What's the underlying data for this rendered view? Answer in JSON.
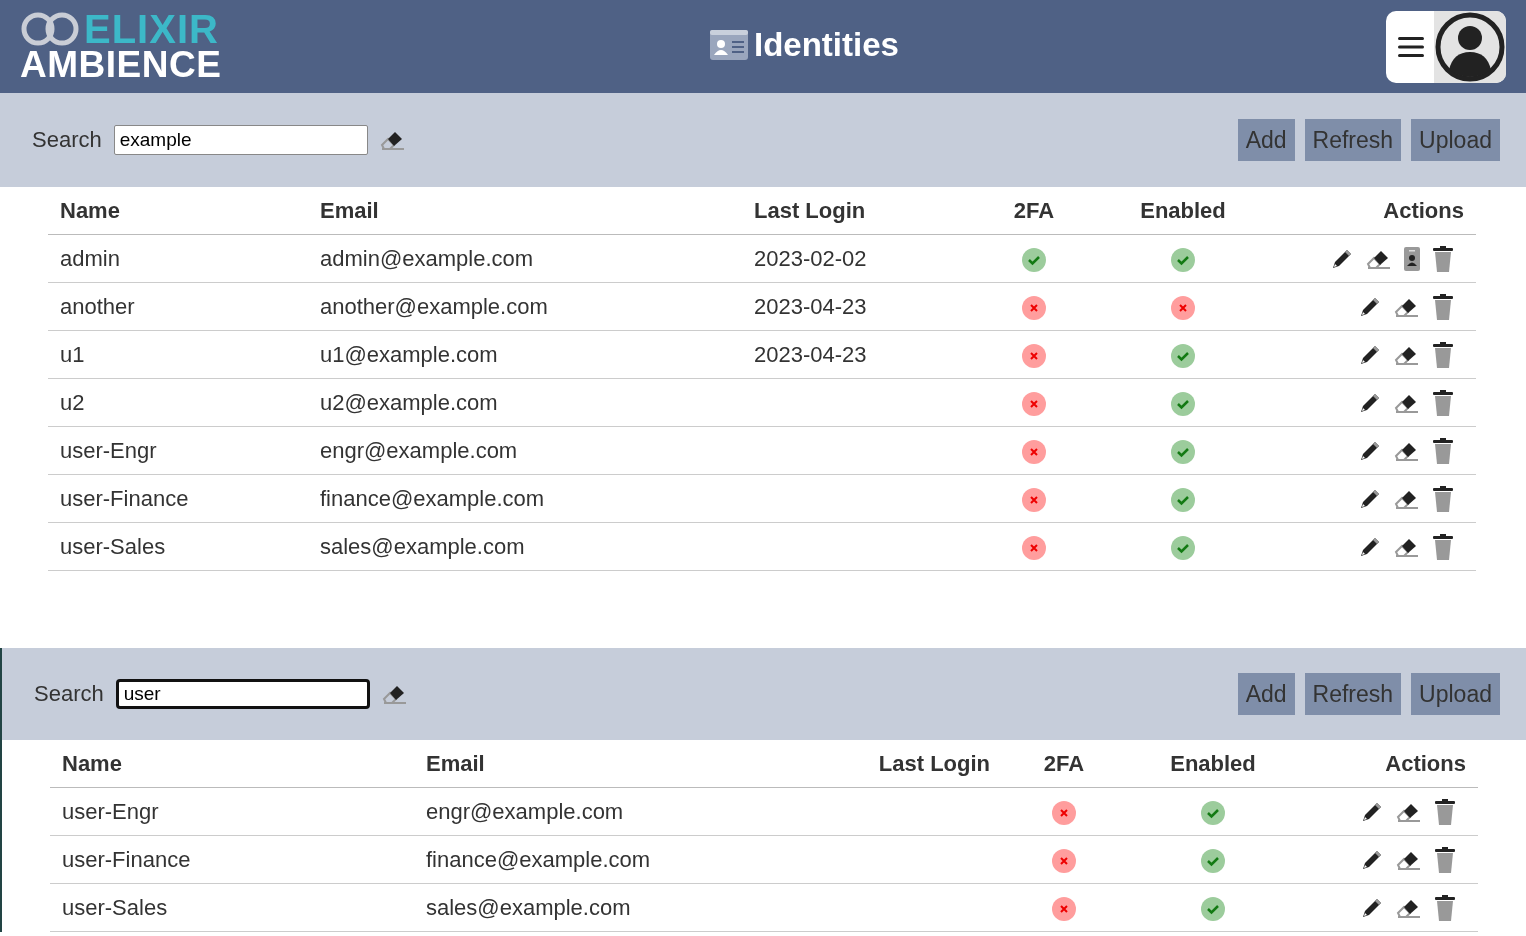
{
  "header": {
    "logo": {
      "top": "ELIXIR",
      "bottom": "AMBIENCE"
    },
    "title": "Identities"
  },
  "panels": [
    {
      "search": {
        "label": "Search",
        "value": "example",
        "focused": false
      },
      "buttons": [
        "Add",
        "Refresh",
        "Upload"
      ],
      "columns": [
        "Name",
        "Email",
        "Last Login",
        "2FA",
        "Enabled",
        "Actions"
      ],
      "rows": [
        {
          "name": "admin",
          "email": "admin@example.com",
          "last_login": "2023-02-02",
          "two_fa": true,
          "enabled": true,
          "badge": true
        },
        {
          "name": "another",
          "email": "another@example.com",
          "last_login": "2023-04-23",
          "two_fa": false,
          "enabled": false,
          "badge": false
        },
        {
          "name": "u1",
          "email": "u1@example.com",
          "last_login": "2023-04-23",
          "two_fa": false,
          "enabled": true,
          "badge": false
        },
        {
          "name": "u2",
          "email": "u2@example.com",
          "two_fa": false,
          "enabled": true,
          "badge": false
        },
        {
          "name": "user-Engr",
          "email": "engr@example.com",
          "two_fa": false,
          "enabled": true,
          "badge": false
        },
        {
          "name": "user-Finance",
          "email": "finance@example.com",
          "two_fa": false,
          "enabled": true,
          "badge": false
        },
        {
          "name": "user-Sales",
          "email": "sales@example.com",
          "two_fa": false,
          "enabled": true,
          "badge": false
        }
      ]
    },
    {
      "search": {
        "label": "Search",
        "value": "user",
        "focused": true
      },
      "buttons": [
        "Add",
        "Refresh",
        "Upload"
      ],
      "columns": [
        "Name",
        "Email",
        "Last Login",
        "2FA",
        "Enabled",
        "Actions"
      ],
      "rows": [
        {
          "name": "user-Engr",
          "email": "engr@example.com",
          "two_fa": false,
          "enabled": true,
          "badge": false
        },
        {
          "name": "user-Finance",
          "email": "finance@example.com",
          "two_fa": false,
          "enabled": true,
          "badge": false
        },
        {
          "name": "user-Sales",
          "email": "sales@example.com",
          "two_fa": false,
          "enabled": true,
          "badge": false
        }
      ]
    }
  ]
}
